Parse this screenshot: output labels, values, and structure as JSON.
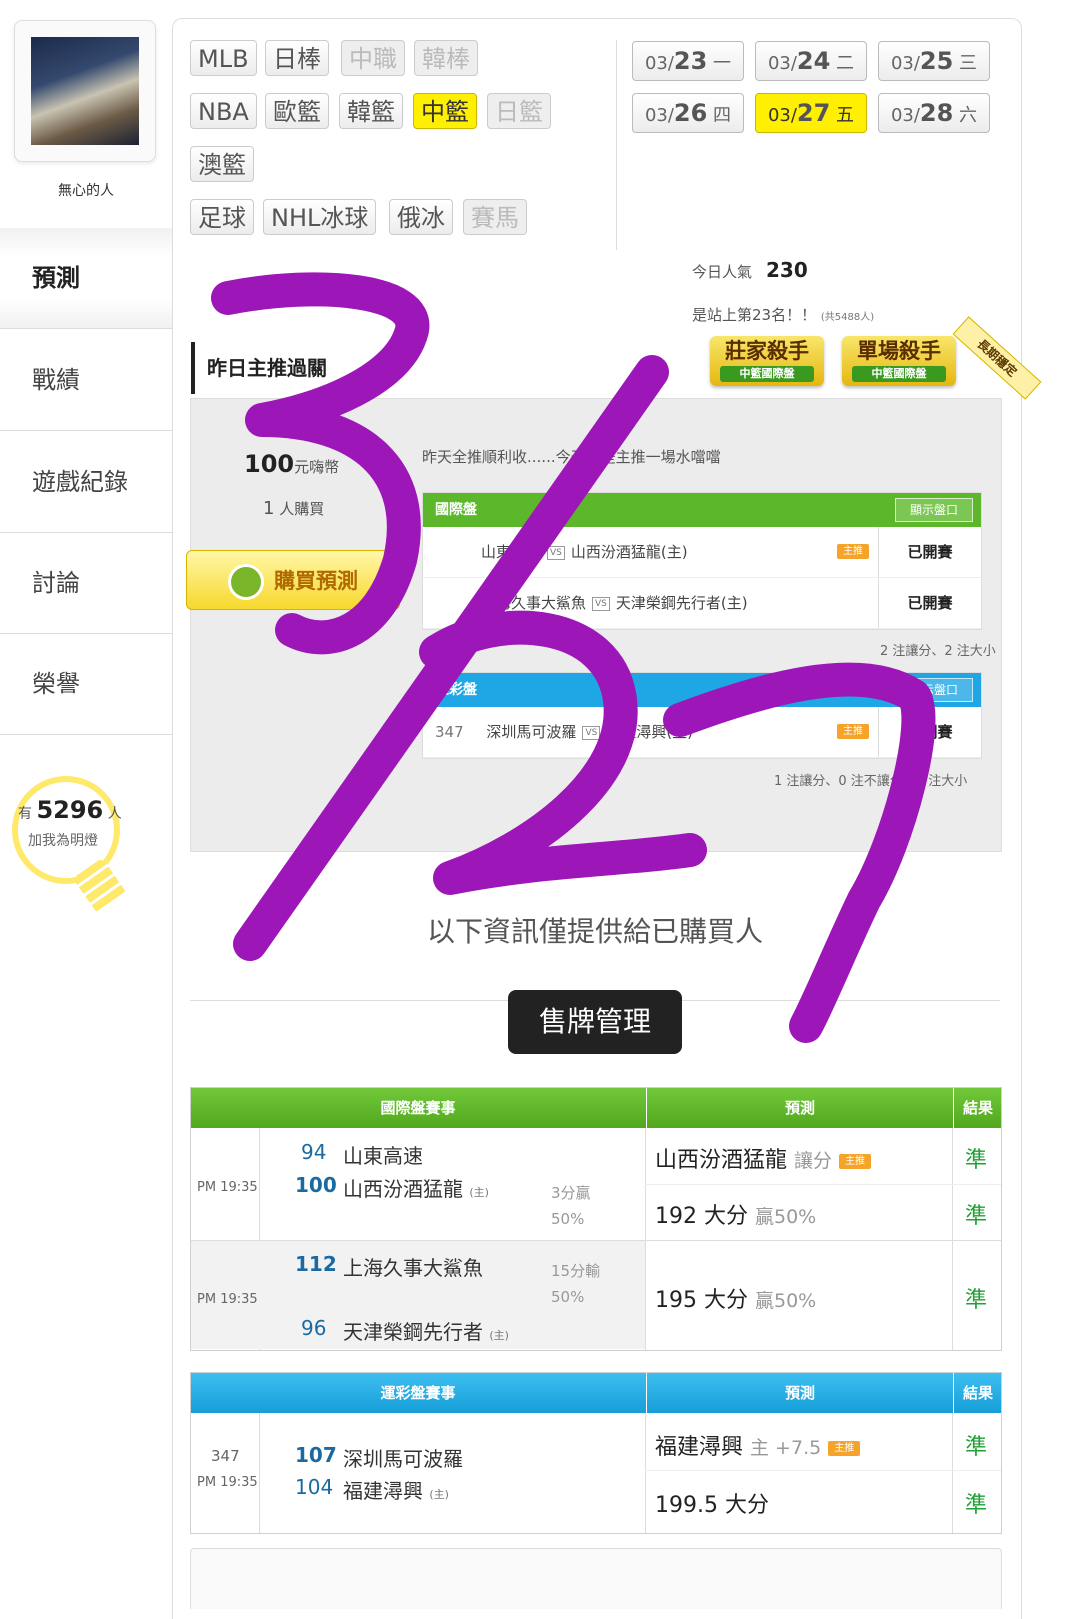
{
  "user": {
    "name": "無心的人"
  },
  "nav": [
    {
      "label": "預測"
    },
    {
      "label": "戰績"
    },
    {
      "label": "遊戲紀錄"
    },
    {
      "label": "討論"
    },
    {
      "label": "榮譽"
    }
  ],
  "fans": {
    "prefix": "有",
    "count": "5296",
    "suffix": "人",
    "sub": "加我為明燈"
  },
  "sports": {
    "row1": [
      "MLB",
      "日棒",
      "中職",
      "韓棒"
    ],
    "row2": [
      "NBA",
      "歐籃",
      "韓籃",
      "中籃",
      "日籃"
    ],
    "row3": [
      "澳籃"
    ],
    "row4": [
      "足球",
      "NHL冰球",
      "俄冰",
      "賽馬"
    ]
  },
  "dates": [
    {
      "md": "03/",
      "d": "23",
      "wd": "一"
    },
    {
      "md": "03/",
      "d": "24",
      "wd": "二"
    },
    {
      "md": "03/",
      "d": "25",
      "wd": "三"
    },
    {
      "md": "03/",
      "d": "26",
      "wd": "四"
    },
    {
      "md": "03/",
      "d": "27",
      "wd": "五"
    },
    {
      "md": "03/",
      "d": "28",
      "wd": "六"
    }
  ],
  "popularity": {
    "label": "今日人氣",
    "value": "230",
    "rank": "是站上第23名！！",
    "total": "(共5488人)"
  },
  "section_title": "昨日主推過關",
  "badges": [
    {
      "title": "莊家殺手",
      "sub": "中籃國際盤"
    },
    {
      "title": "單場殺手",
      "sub": "中籃國際盤"
    }
  ],
  "ribbon": "長期穩定",
  "price": {
    "amount": "100",
    "unit": "元嗨幣",
    "buyers_num": "1",
    "buyers_label": "人購買"
  },
  "buy_button": "購買預測",
  "comment": "昨天全推順利收......今天也是主推一場水噹噹",
  "mini_intl": {
    "title": "國際盤",
    "button": "顯示盤口",
    "rows": [
      {
        "home": "山東高速",
        "away": "山西汾酒猛龍(主)",
        "tag": "主推",
        "status": "已開賽"
      },
      {
        "home": "上海久事大鯊魚",
        "away": "天津榮鋼先行者(主)",
        "tag": "",
        "status": "已開賽"
      }
    ],
    "note": "2 注讓分、2 注大小"
  },
  "mini_lottery": {
    "title": "運彩盤",
    "button": "顯示盤口",
    "rows": [
      {
        "num": "347",
        "home": "深圳馬可波羅",
        "away": "福建潯興(主)",
        "tag": "主推",
        "status": "已開賽"
      }
    ],
    "note": "1 注讓分、0 注不讓分、1 注大小"
  },
  "info_text": "以下資訊僅提供給已購買人",
  "sell_button": "售牌管理",
  "intl_table": {
    "h_event": "國際盤賽事",
    "h_pred": "預測",
    "h_result": "結果",
    "games": [
      {
        "time": "PM 19:35",
        "s1": "94",
        "t1": "山東高速",
        "s2": "100",
        "t2": "山西汾酒猛龍",
        "t2tag": "(主)",
        "res": "3分贏",
        "pct": "50%",
        "p1": "山西汾酒猛龍",
        "p1g": "讓分",
        "p1tag": "主推",
        "r1": "準",
        "p2": "192 大分",
        "p2g": "贏50%",
        "r2": "準"
      },
      {
        "time": "PM 19:35",
        "s1": "112",
        "t1": "上海久事大鯊魚",
        "s2": "96",
        "t2": "天津榮鋼先行者",
        "t2tag": "(主)",
        "res": "15分輸",
        "pct": "50%",
        "p1": "195 大分",
        "p1g": "贏50%",
        "r1": "準"
      }
    ]
  },
  "lottery_table": {
    "h_event": "運彩盤賽事",
    "h_pred": "預測",
    "h_result": "結果",
    "game": {
      "num": "347",
      "time": "PM 19:35",
      "s1": "107",
      "t1": "深圳馬可波羅",
      "s2": "104",
      "t2": "福建潯興",
      "t2tag": "(主)",
      "p1": "福建潯興",
      "p1g": "主 +7.5",
      "p1tag": "主推",
      "r1": "準",
      "p2": "199.5 大分",
      "r2": "準"
    }
  },
  "handwriting": "3/27",
  "colors": {
    "highlight": "#ffef00",
    "intl_green": "#5cb82a",
    "lottery_blue": "#1ea7e4",
    "ink": "#9c16b8",
    "ok": "#21a035"
  }
}
